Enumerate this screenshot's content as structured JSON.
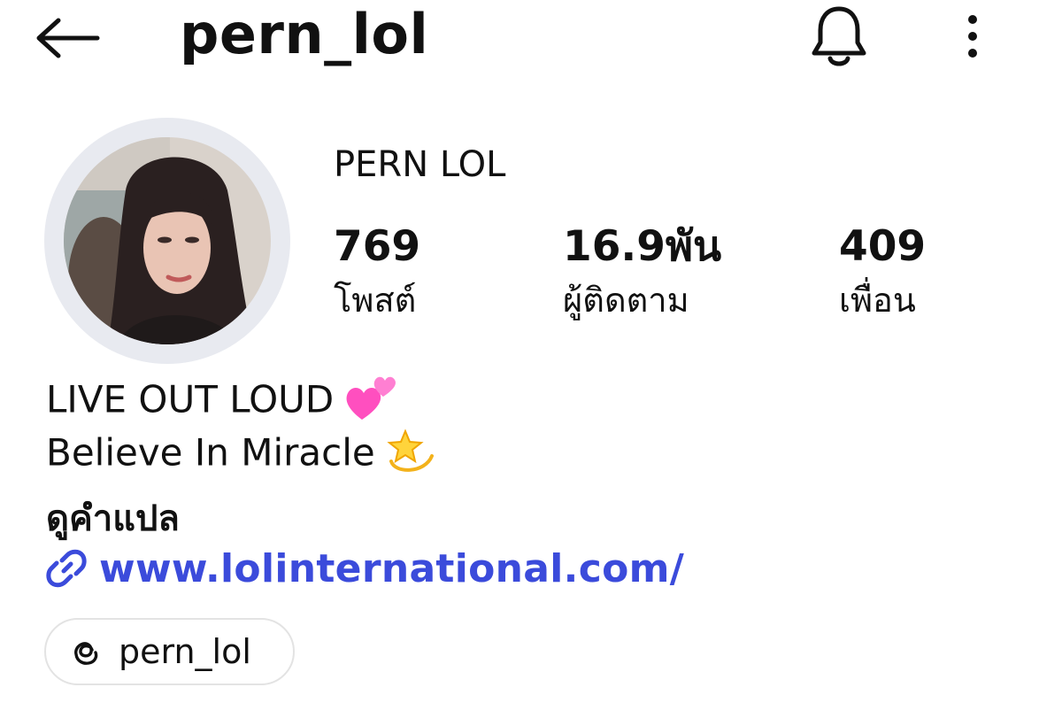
{
  "header": {
    "username": "pern_lol",
    "back_icon": "arrow-left-icon",
    "bell_icon": "bell-icon",
    "more_icon": "more-vertical-icon"
  },
  "profile": {
    "display_name": "PERN LOL",
    "avatar_icon": "profile-photo",
    "stats": [
      {
        "value": "769",
        "label": "โพสต์"
      },
      {
        "value": "16.9พัน",
        "label": "ผู้ติดตาม"
      },
      {
        "value": "409",
        "label": "เพื่อน"
      }
    ]
  },
  "bio": {
    "line1": "LIVE OUT LOUD",
    "line1_emoji_icon": "two-hearts-icon",
    "line2": "Believe In Miracle",
    "line2_emoji_icon": "dizzy-star-icon",
    "translate_label": "ดูคำแปล",
    "website": "www.lolinternational.com/",
    "link_icon": "link-icon"
  },
  "threads": {
    "handle": "pern_lol",
    "icon": "threads-icon"
  },
  "colors": {
    "link": "#3b4bdb",
    "text": "#111111",
    "avatar_ring": "#e8eaf0",
    "chip_border": "#e3e3e3"
  }
}
